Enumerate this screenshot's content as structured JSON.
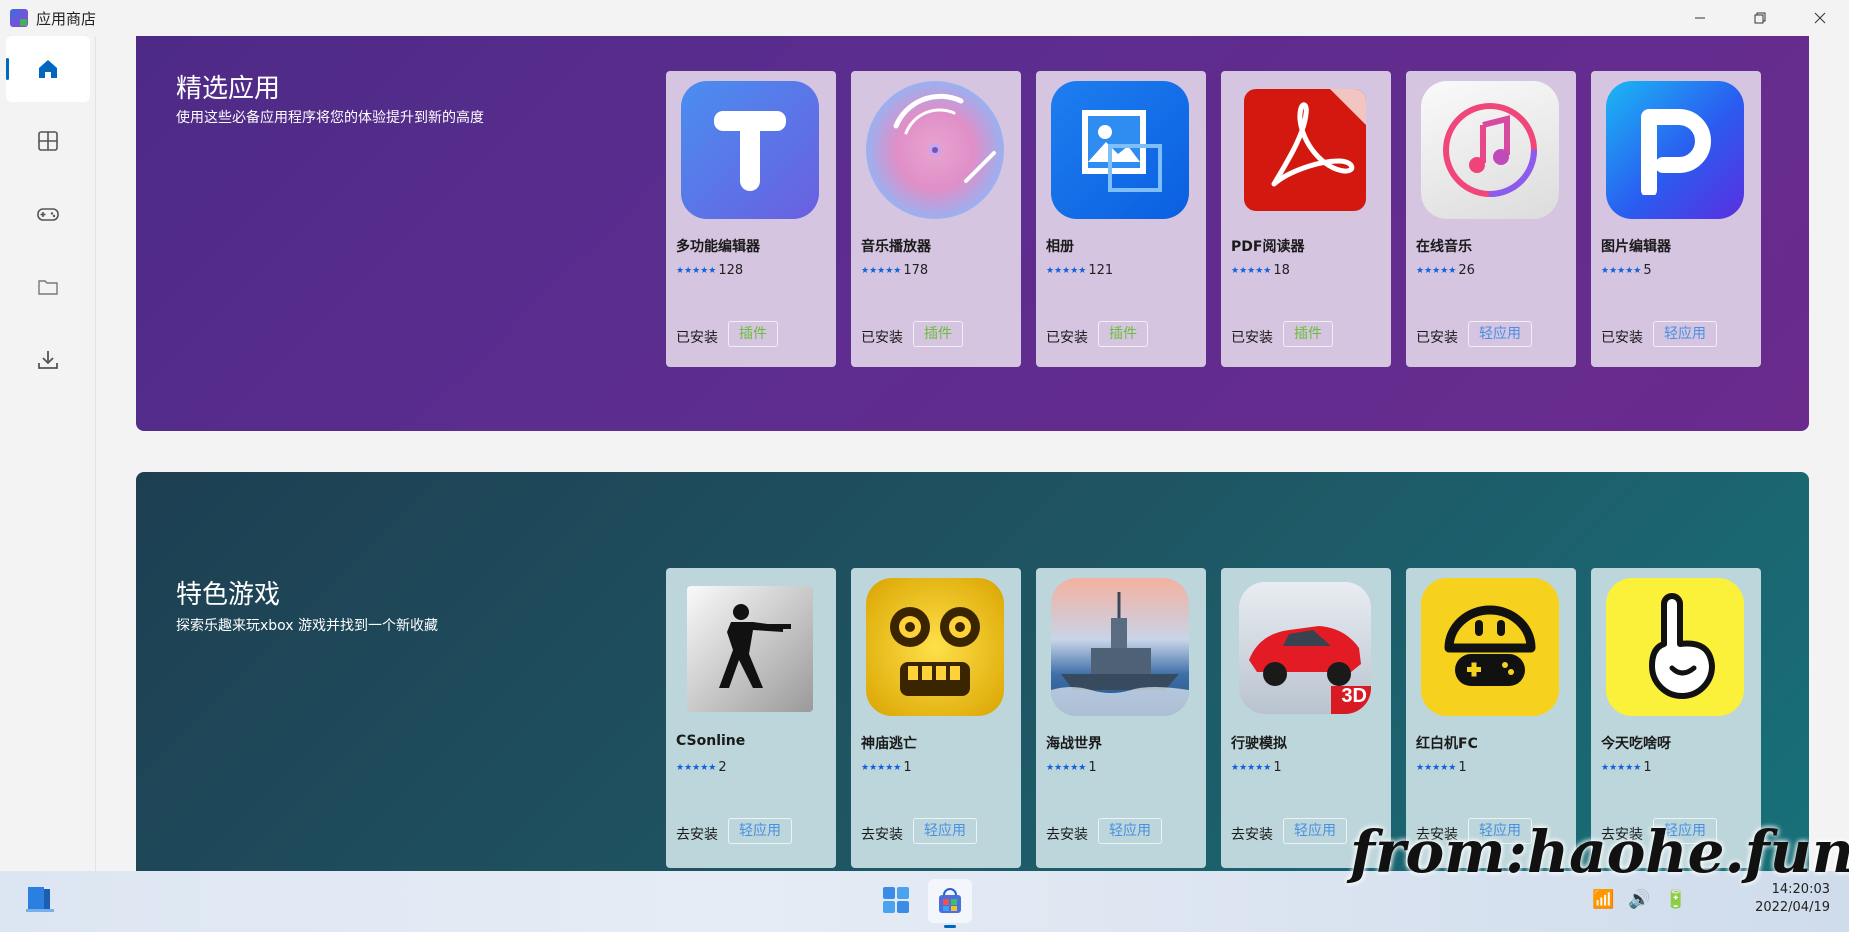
{
  "window": {
    "title": "应用商店"
  },
  "featured": {
    "title": "精选应用",
    "desc": "使用这些必备应用程序将您的体验提升到新的高度",
    "apps": [
      {
        "name": "多功能编辑器",
        "count": "128",
        "status": "已安装",
        "tag": "插件"
      },
      {
        "name": "音乐播放器",
        "count": "178",
        "status": "已安装",
        "tag": "插件"
      },
      {
        "name": "相册",
        "count": "121",
        "status": "已安装",
        "tag": "插件"
      },
      {
        "name": "PDF阅读器",
        "count": "18",
        "status": "已安装",
        "tag": "插件"
      },
      {
        "name": "在线音乐",
        "count": "26",
        "status": "已安装",
        "tag": "轻应用"
      },
      {
        "name": "图片编辑器",
        "count": "5",
        "status": "已安装",
        "tag": "轻应用"
      }
    ]
  },
  "games": {
    "title": "特色游戏",
    "desc": "探索乐趣来玩xbox 游戏并找到一个新收藏",
    "apps": [
      {
        "name": "CSonline",
        "count": "2",
        "status": "去安装",
        "tag": "轻应用"
      },
      {
        "name": "神庙逃亡",
        "count": "1",
        "status": "去安装",
        "tag": "轻应用"
      },
      {
        "name": "海战世界",
        "count": "1",
        "status": "去安装",
        "tag": "轻应用"
      },
      {
        "name": "行驶模拟",
        "count": "1",
        "status": "去安装",
        "tag": "轻应用"
      },
      {
        "name": "红白机FC",
        "count": "1",
        "status": "去安装",
        "tag": "轻应用"
      },
      {
        "name": "今天吃啥呀",
        "count": "1",
        "status": "去安装",
        "tag": "轻应用"
      }
    ]
  },
  "stars": "★★★★★",
  "taskbar": {
    "time": "14:20:03",
    "date": "2022/04/19"
  },
  "watermark": "from:haohe.fun",
  "colors": {
    "accent": "#0067c0",
    "plugin_tag": "#6cbe3a",
    "lite_tag": "#4a90e2",
    "star": "#1062d8"
  }
}
